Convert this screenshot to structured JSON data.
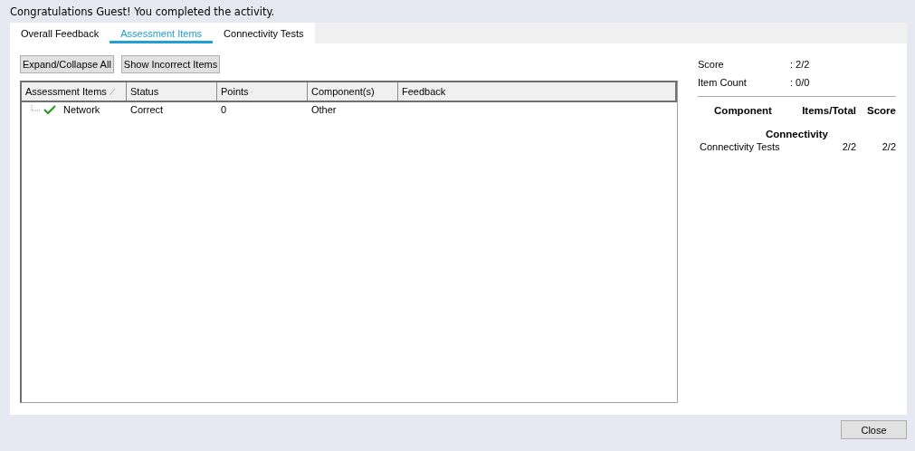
{
  "message": "Congratulations Guest! You completed the activity.",
  "tabs": [
    {
      "label": "Overall Feedback",
      "selected": false
    },
    {
      "label": "Assessment Items",
      "selected": true
    },
    {
      "label": "Connectivity Tests",
      "selected": false
    }
  ],
  "toolbar": [
    "Expand/Collapse All",
    "Show Incorrect Items"
  ],
  "table": {
    "columns": [
      {
        "label": "Assessment Items",
        "sorted": true
      },
      {
        "label": "Status",
        "sorted": false
      },
      {
        "label": "Points",
        "sorted": false
      },
      {
        "label": "Component(s)",
        "sorted": false
      },
      {
        "label": "Feedback",
        "sorted": false
      }
    ],
    "rows": [
      {
        "item": "Network",
        "correct": true,
        "status": "Correct",
        "points": "0",
        "component": "Other",
        "feedback": ""
      }
    ]
  },
  "summary": {
    "fields": [
      {
        "label": "Score",
        "value": ": 2/2"
      },
      {
        "label": "Item Count",
        "value": ": 0/0"
      }
    ],
    "columns": [
      "Component",
      "Items/Total",
      "Score"
    ],
    "groups": [
      {
        "title": "Connectivity",
        "rows": [
          {
            "component": "Connectivity Tests",
            "items": "2/2",
            "score": "2/2"
          }
        ]
      }
    ]
  },
  "close_button": "Close"
}
